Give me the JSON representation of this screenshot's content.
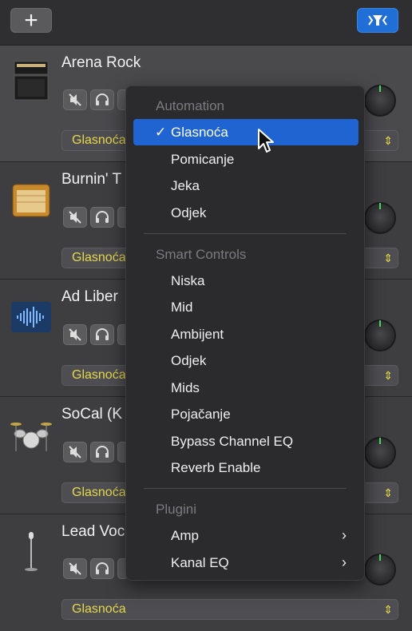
{
  "toolbar": {
    "add_label": "+",
    "add_icon": "plus-icon",
    "filter_icon": "track-filter-icon"
  },
  "tracks": [
    {
      "name": "Arena Rock",
      "icon": "amp-stack-icon",
      "param": "Glasnoća"
    },
    {
      "name": "Burnin' T",
      "icon": "combo-amp-icon",
      "param": "Glasnoća"
    },
    {
      "name": "Ad Liber",
      "icon": "waveform-icon",
      "param": "Glasnoća"
    },
    {
      "name": "SoCal (K",
      "icon": "drum-kit-icon",
      "param": "Glasnoća"
    },
    {
      "name": "Lead Voc",
      "icon": "microphone-icon",
      "param": "Glasnoća"
    }
  ],
  "menu": {
    "automation_header": "Automation",
    "automation_items": [
      "Glasnoća",
      "Pomicanje",
      "Jeka",
      "Odjek"
    ],
    "selected_check": "✓",
    "smart_header": "Smart Controls",
    "smart_items": [
      "Niska",
      "Mid",
      "Ambijent",
      "Odjek",
      "Mids",
      "Pojačanje",
      "Bypass Channel EQ",
      "Reverb Enable"
    ],
    "plugins_header": "Plugini",
    "plugin_items": [
      "Amp",
      "Kanal EQ"
    ],
    "submenu_chevron": "›"
  },
  "colors": {
    "accent": "#1f64d1",
    "param_text": "#e6d84a",
    "knob_indicator": "#4cd964"
  }
}
